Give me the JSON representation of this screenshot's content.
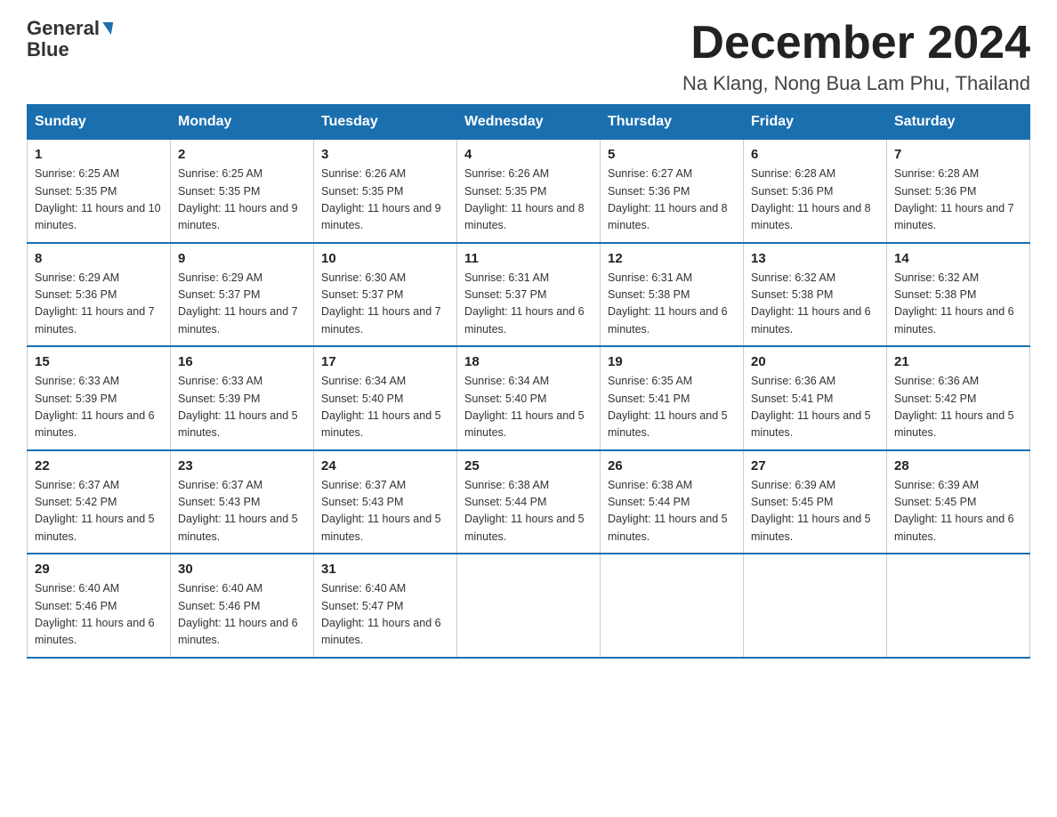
{
  "header": {
    "logo_general": "General",
    "logo_blue": "Blue",
    "month_year": "December 2024",
    "location": "Na Klang, Nong Bua Lam Phu, Thailand"
  },
  "days_of_week": [
    "Sunday",
    "Monday",
    "Tuesday",
    "Wednesday",
    "Thursday",
    "Friday",
    "Saturday"
  ],
  "weeks": [
    [
      {
        "num": "1",
        "sunrise": "6:25 AM",
        "sunset": "5:35 PM",
        "daylight": "11 hours and 10 minutes."
      },
      {
        "num": "2",
        "sunrise": "6:25 AM",
        "sunset": "5:35 PM",
        "daylight": "11 hours and 9 minutes."
      },
      {
        "num": "3",
        "sunrise": "6:26 AM",
        "sunset": "5:35 PM",
        "daylight": "11 hours and 9 minutes."
      },
      {
        "num": "4",
        "sunrise": "6:26 AM",
        "sunset": "5:35 PM",
        "daylight": "11 hours and 8 minutes."
      },
      {
        "num": "5",
        "sunrise": "6:27 AM",
        "sunset": "5:36 PM",
        "daylight": "11 hours and 8 minutes."
      },
      {
        "num": "6",
        "sunrise": "6:28 AM",
        "sunset": "5:36 PM",
        "daylight": "11 hours and 8 minutes."
      },
      {
        "num": "7",
        "sunrise": "6:28 AM",
        "sunset": "5:36 PM",
        "daylight": "11 hours and 7 minutes."
      }
    ],
    [
      {
        "num": "8",
        "sunrise": "6:29 AM",
        "sunset": "5:36 PM",
        "daylight": "11 hours and 7 minutes."
      },
      {
        "num": "9",
        "sunrise": "6:29 AM",
        "sunset": "5:37 PM",
        "daylight": "11 hours and 7 minutes."
      },
      {
        "num": "10",
        "sunrise": "6:30 AM",
        "sunset": "5:37 PM",
        "daylight": "11 hours and 7 minutes."
      },
      {
        "num": "11",
        "sunrise": "6:31 AM",
        "sunset": "5:37 PM",
        "daylight": "11 hours and 6 minutes."
      },
      {
        "num": "12",
        "sunrise": "6:31 AM",
        "sunset": "5:38 PM",
        "daylight": "11 hours and 6 minutes."
      },
      {
        "num": "13",
        "sunrise": "6:32 AM",
        "sunset": "5:38 PM",
        "daylight": "11 hours and 6 minutes."
      },
      {
        "num": "14",
        "sunrise": "6:32 AM",
        "sunset": "5:38 PM",
        "daylight": "11 hours and 6 minutes."
      }
    ],
    [
      {
        "num": "15",
        "sunrise": "6:33 AM",
        "sunset": "5:39 PM",
        "daylight": "11 hours and 6 minutes."
      },
      {
        "num": "16",
        "sunrise": "6:33 AM",
        "sunset": "5:39 PM",
        "daylight": "11 hours and 5 minutes."
      },
      {
        "num": "17",
        "sunrise": "6:34 AM",
        "sunset": "5:40 PM",
        "daylight": "11 hours and 5 minutes."
      },
      {
        "num": "18",
        "sunrise": "6:34 AM",
        "sunset": "5:40 PM",
        "daylight": "11 hours and 5 minutes."
      },
      {
        "num": "19",
        "sunrise": "6:35 AM",
        "sunset": "5:41 PM",
        "daylight": "11 hours and 5 minutes."
      },
      {
        "num": "20",
        "sunrise": "6:36 AM",
        "sunset": "5:41 PM",
        "daylight": "11 hours and 5 minutes."
      },
      {
        "num": "21",
        "sunrise": "6:36 AM",
        "sunset": "5:42 PM",
        "daylight": "11 hours and 5 minutes."
      }
    ],
    [
      {
        "num": "22",
        "sunrise": "6:37 AM",
        "sunset": "5:42 PM",
        "daylight": "11 hours and 5 minutes."
      },
      {
        "num": "23",
        "sunrise": "6:37 AM",
        "sunset": "5:43 PM",
        "daylight": "11 hours and 5 minutes."
      },
      {
        "num": "24",
        "sunrise": "6:37 AM",
        "sunset": "5:43 PM",
        "daylight": "11 hours and 5 minutes."
      },
      {
        "num": "25",
        "sunrise": "6:38 AM",
        "sunset": "5:44 PM",
        "daylight": "11 hours and 5 minutes."
      },
      {
        "num": "26",
        "sunrise": "6:38 AM",
        "sunset": "5:44 PM",
        "daylight": "11 hours and 5 minutes."
      },
      {
        "num": "27",
        "sunrise": "6:39 AM",
        "sunset": "5:45 PM",
        "daylight": "11 hours and 5 minutes."
      },
      {
        "num": "28",
        "sunrise": "6:39 AM",
        "sunset": "5:45 PM",
        "daylight": "11 hours and 6 minutes."
      }
    ],
    [
      {
        "num": "29",
        "sunrise": "6:40 AM",
        "sunset": "5:46 PM",
        "daylight": "11 hours and 6 minutes."
      },
      {
        "num": "30",
        "sunrise": "6:40 AM",
        "sunset": "5:46 PM",
        "daylight": "11 hours and 6 minutes."
      },
      {
        "num": "31",
        "sunrise": "6:40 AM",
        "sunset": "5:47 PM",
        "daylight": "11 hours and 6 minutes."
      },
      null,
      null,
      null,
      null
    ]
  ]
}
